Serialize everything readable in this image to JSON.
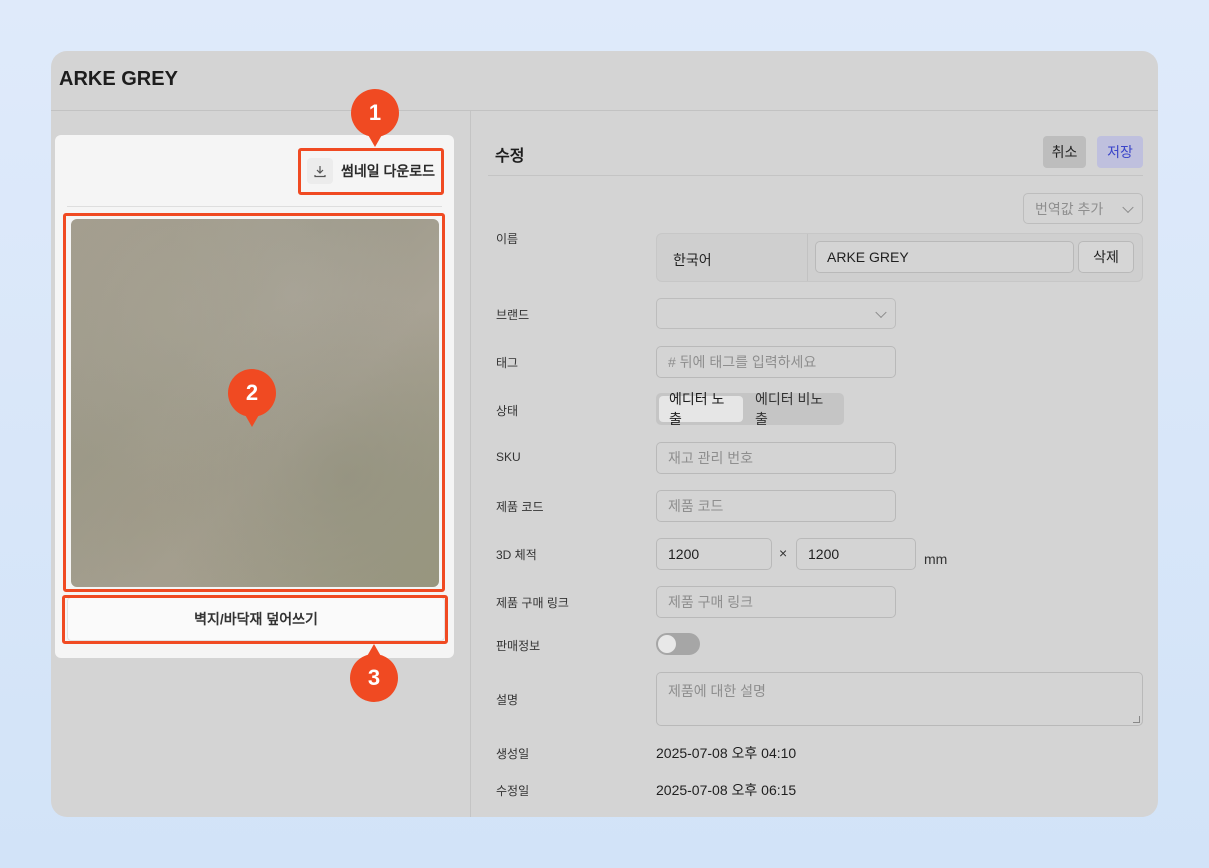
{
  "window": {
    "title": "ARKE GREY"
  },
  "thumbnail_panel": {
    "download_label": "썸네일 다운로드",
    "overwrite_label": "벽지/바닥재 덮어쓰기"
  },
  "edit_panel": {
    "title": "수정",
    "cancel_label": "취소",
    "save_label": "저장",
    "translation_select_placeholder": "번역값 추가",
    "fields": {
      "name": {
        "label": "이름",
        "language": "한국어",
        "value": "ARKE GREY",
        "delete_label": "삭제"
      },
      "brand": {
        "label": "브랜드",
        "value": ""
      },
      "tag": {
        "label": "태그",
        "placeholder": "# 뒤에 태그를 입력하세요"
      },
      "status": {
        "label": "상태",
        "options": [
          "에디터 노출",
          "에디터 비노출"
        ],
        "selected": "에디터 노출"
      },
      "sku": {
        "label": "SKU",
        "placeholder": "재고 관리 번호"
      },
      "product_code": {
        "label": "제품 코드",
        "placeholder": "제품 코드"
      },
      "dimensions": {
        "label": "3D 체적",
        "width": "1200",
        "height": "1200",
        "separator": "×",
        "unit": "mm"
      },
      "purchase_link": {
        "label": "제품 구매 링크",
        "placeholder": "제품 구매 링크"
      },
      "sales_info": {
        "label": "판매정보",
        "enabled": false
      },
      "description": {
        "label": "설명",
        "placeholder": "제품에 대한 설명"
      },
      "created": {
        "label": "생성일",
        "value": "2025-07-08 오후 04:10"
      },
      "modified": {
        "label": "수정일",
        "value": "2025-07-08 오후 06:15"
      }
    }
  },
  "annotations": [
    {
      "number": "1",
      "target": "썸네일 다운로드"
    },
    {
      "number": "2",
      "target": "thumbnail image"
    },
    {
      "number": "3",
      "target": "벽지/바닥재 덮어쓰기"
    }
  ],
  "colors": {
    "highlight": "#f04a22",
    "save_text": "#3b45c9",
    "save_bg": "#bfc0de",
    "overlay": "#d4d4d4"
  }
}
